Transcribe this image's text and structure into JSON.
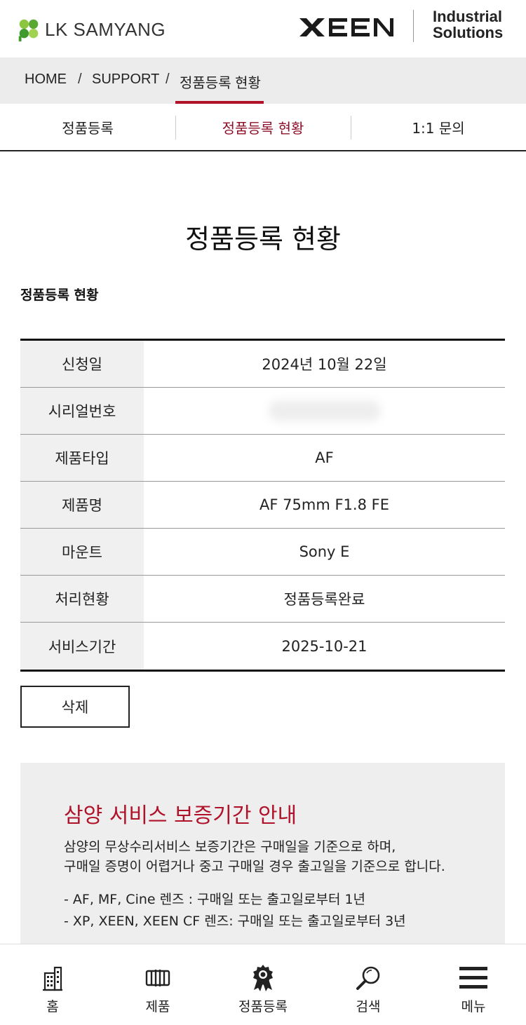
{
  "header": {
    "brand_text": "LK SAMYANG",
    "brand_icon": "clover-logo-icon",
    "xeen_logo_text": "XEEN",
    "industrial_line1": "Industrial",
    "industrial_line2": "Solutions"
  },
  "breadcrumb": {
    "items": [
      "HOME",
      "SUPPORT",
      "정품등록 현황"
    ],
    "separator": "/"
  },
  "tabs": [
    {
      "label": "정품등록",
      "active": false
    },
    {
      "label": "정품등록 현황",
      "active": true
    },
    {
      "label": "1:1 문의",
      "active": false
    }
  ],
  "main": {
    "page_title": "정품등록 현황",
    "section_title": "정품등록 현황"
  },
  "details": {
    "rows": [
      {
        "label": "신청일",
        "value": "2024년 10월 22일"
      },
      {
        "label": "시리얼번호",
        "value": ""
      },
      {
        "label": "제품타입",
        "value": "AF"
      },
      {
        "label": "제품명",
        "value": "AF 75mm F1.8 FE"
      },
      {
        "label": "마운트",
        "value": "Sony E"
      },
      {
        "label": "처리현황",
        "value": "정품등록완료"
      },
      {
        "label": "서비스기간",
        "value": "2025-10-21"
      }
    ]
  },
  "actions": {
    "delete_label": "삭제"
  },
  "notice": {
    "title": "삼양 서비스 보증기간 안내",
    "body_line1": "삼양의 무상수리서비스 보증기간은 구매일을 기준으로 하며,",
    "body_line2": "구매일 증명이 어렵거나 중고 구매일 경우 출고일을 기준으로 합니다.",
    "list": [
      "- AF, MF, Cine 렌즈 : 구매일 또는 출고일로부터 1년",
      "- XP, XEEN, XEEN CF 렌즈: 구매일 또는 출고일로부터 3년"
    ]
  },
  "bottom_nav": [
    {
      "label": "홈",
      "icon": "building-icon"
    },
    {
      "label": "제품",
      "icon": "lens-icon"
    },
    {
      "label": "정품등록",
      "icon": "award-badge-icon"
    },
    {
      "label": "검색",
      "icon": "search-icon"
    },
    {
      "label": "메뉴",
      "icon": "hamburger-menu-icon"
    }
  ],
  "colors": {
    "accent": "#b0122a",
    "active_tab": "#8c1027",
    "breadcrumb_bg": "#ececec",
    "notice_bg": "#eeeeee",
    "label_bg": "#f0f0f0"
  }
}
